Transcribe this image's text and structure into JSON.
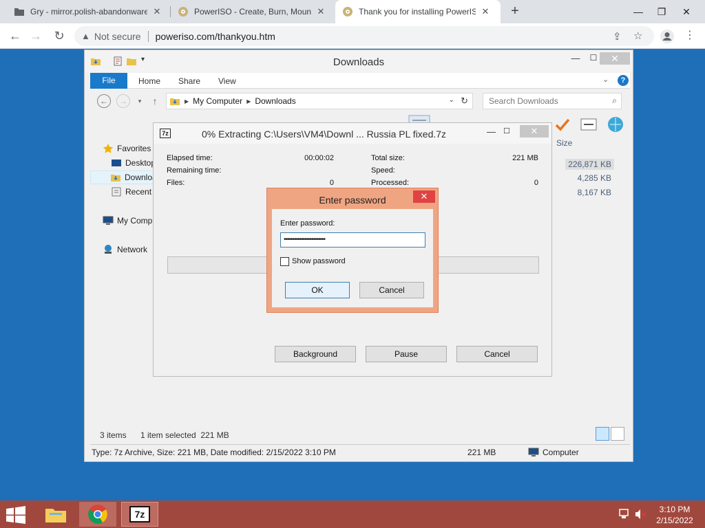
{
  "browser": {
    "tabs": [
      {
        "label": "Gry - mirror.polish-abandonware",
        "close": "✕"
      },
      {
        "label": "PowerISO - Create, Burn, Mount,",
        "close": "✕"
      },
      {
        "label": "Thank you for installing PowerISO",
        "close": "✕"
      }
    ],
    "new_tab": "+",
    "omnibox": {
      "security": "Not secure",
      "url": "poweriso.com/thankyou.htm"
    }
  },
  "explorer": {
    "title": "Downloads",
    "ribbon": {
      "file": "File",
      "tabs": [
        "Home",
        "Share",
        "View"
      ]
    },
    "breadcrumb": [
      "My Computer",
      "Downloads"
    ],
    "search_placeholder": "Search Downloads",
    "nav": [
      {
        "label": "Favorites"
      },
      {
        "label": "Desktop"
      },
      {
        "label": "Downloads"
      },
      {
        "label": "Recent places"
      },
      {
        "label": "My Computer"
      },
      {
        "label": "Network"
      }
    ],
    "columns": {
      "size": "Size"
    },
    "file_sizes": [
      "226,871 KB",
      "4,285 KB",
      "8,167 KB"
    ],
    "status": {
      "count": "3 items",
      "selection": "1 item selected  221 MB"
    },
    "details": {
      "info": "Type: 7z Archive, Size: 221 MB, Date modified: 2/15/2022 3:10 PM",
      "size": "221 MB",
      "location": "Computer"
    }
  },
  "sevenzip": {
    "title": "0% Extracting C:\\Users\\VM4\\Downl ... Russia PL fixed.7z",
    "icon_text": "7z",
    "fields_left": [
      {
        "label": "Elapsed time:",
        "value": "00:00:02"
      },
      {
        "label": "Remaining time:",
        "value": ""
      },
      {
        "label": "Files:",
        "value": "0"
      }
    ],
    "fields_right": [
      {
        "label": "Total size:",
        "value": "221 MB"
      },
      {
        "label": "Speed:",
        "value": ""
      },
      {
        "label": "Processed:",
        "value": "0"
      }
    ],
    "progress": 0,
    "buttons": {
      "background": "Background",
      "pause": "Pause",
      "cancel": "Cancel"
    }
  },
  "password_dialog": {
    "title": "Enter password",
    "label": "Enter password:",
    "value": "••••••••••••••••••••••••",
    "show_password": "Show password",
    "ok": "OK",
    "cancel": "Cancel"
  },
  "taskbar": {
    "time": "3:10 PM",
    "date": "2/15/2022",
    "app_7z": "7z"
  },
  "colors": {
    "accent": "#1979ca",
    "taskbar": "#a1483e",
    "desktop": "#1f6fb8",
    "dialog_frame": "#f0a582",
    "close_red": "#e04343"
  }
}
